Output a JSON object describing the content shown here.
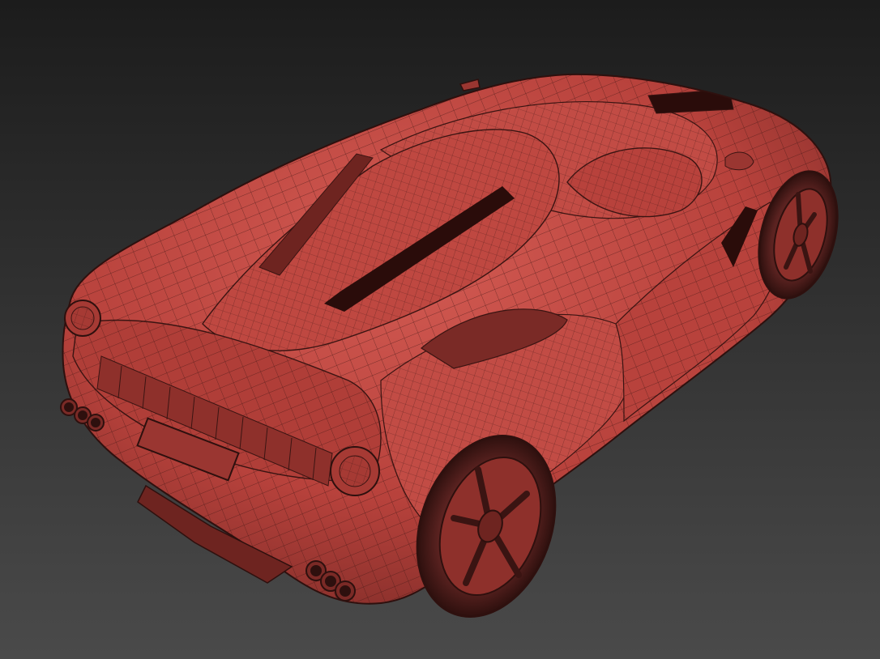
{
  "viewport": {
    "background_top": "#1c1c1c",
    "background_bottom": "#4a4a4a"
  },
  "model": {
    "subject": "sports-car-wireframe",
    "body_color": "#b8423c",
    "body_highlight": "#d25a52",
    "body_shadow": "#6e2420",
    "wire_color": "#3a1412",
    "tire_color": "#3c1a18"
  }
}
